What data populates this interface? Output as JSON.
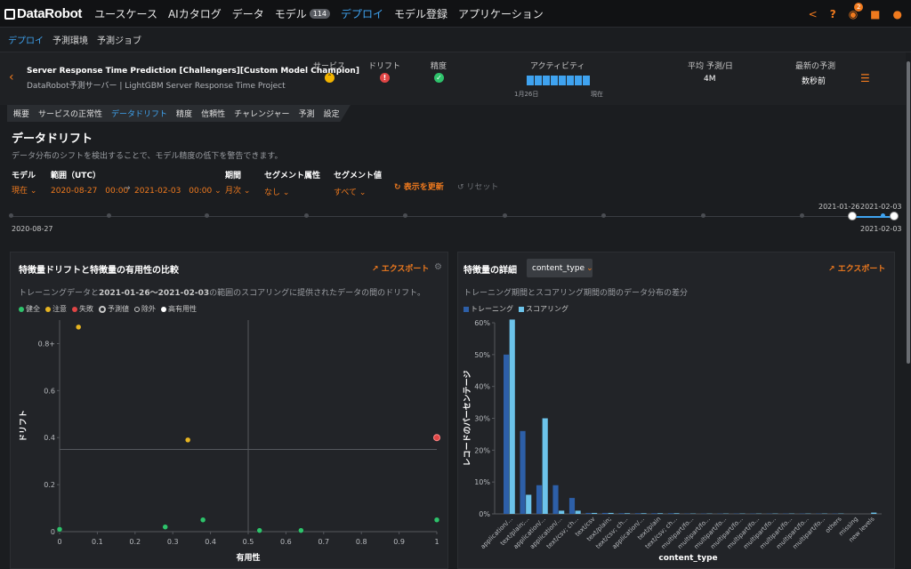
{
  "topbar": {
    "logo": "DataRobot",
    "nav": [
      "ユースケース",
      "AIカタログ",
      "データ",
      "モデル",
      "デプロイ",
      "モデル登録",
      "アプリケーション"
    ],
    "model_badge": "114",
    "notif_count": "2",
    "icons": [
      "share-icon",
      "help-icon",
      "bell-icon",
      "folder-icon",
      "user-icon"
    ]
  },
  "subnav": [
    "デプロイ",
    "予測環境",
    "予測ジョブ"
  ],
  "deployment": {
    "title": "Server Response Time Prediction [Challengers][Custom Model Champion]",
    "subtitle": "DataRobot予測サーバー | LightGBM Server Response Time Project",
    "service_label": "サービス",
    "drift_label": "ドリフト",
    "accuracy_label": "精度",
    "activity_label": "アクティビティ",
    "activity_start": "1月26日",
    "activity_end": "現在",
    "avg_label": "平均 予測/日",
    "avg_value": "4M",
    "latest_label": "最新の予測",
    "latest_value": "数秒前",
    "status_colors": {
      "service": "#f2b400",
      "drift": "#e04545",
      "accuracy": "#2ec26b"
    }
  },
  "tabs": [
    "概要",
    "サービスの正常性",
    "データドリフト",
    "精度",
    "信頼性",
    "チャレンジャー",
    "予測",
    "設定"
  ],
  "page": {
    "title": "データドリフト",
    "description": "データ分布のシフトを検出することで、モデル精度の低下を警告できます。"
  },
  "controls": {
    "model_label": "モデル",
    "model_value": "現在",
    "range_label": "範囲（UTC）",
    "range_start": "2020-08-27　00:00",
    "range_end": "2021-02-03　00:00",
    "period_label": "期間",
    "period_value": "月次",
    "segment_attr_label": "セグメント属性",
    "segment_attr_value": "なし",
    "segment_val_label": "セグメント値",
    "segment_val_value": "すべて",
    "refresh": "表示を更新",
    "reset": "リセット"
  },
  "timeline": {
    "start": "2020-08-27",
    "end": "2021-02-03",
    "sel_start": "2021-01-26",
    "sel_end": "2021-02-03"
  },
  "left_panel": {
    "title": "特徴量ドリフトと特徴量の有用性の比較",
    "export": "エクスポート",
    "desc_pre": "トレーニングデータと",
    "desc_range": "2021-01-26〜2021-02-03",
    "desc_post": "の範囲のスコアリングに提供されたデータの間のドリフト。",
    "legend": [
      "健全",
      "注意",
      "失敗",
      "予測値",
      "除外",
      "高有用性"
    ]
  },
  "right_panel": {
    "title": "特徴量の詳細",
    "select_value": "content_type",
    "export": "エクスポート",
    "desc": "トレーニング期間とスコアリング期間の間のデータ分布の差分",
    "legend": [
      "トレーニング",
      "スコアリング"
    ]
  },
  "chart_data": [
    {
      "type": "scatter",
      "xlabel": "有用性",
      "ylabel": "ドリフト",
      "xlim": [
        0,
        1
      ],
      "ylim": [
        0,
        0.9
      ],
      "x_ticks": [
        "0",
        "0.1",
        "0.2",
        "0.3",
        "0.4",
        "0.5",
        "0.6",
        "0.7",
        "0.8",
        "0.9",
        "1"
      ],
      "y_ticks": [
        "0",
        "0.2",
        "0.4",
        "0.6",
        "0.8+"
      ],
      "thresholds": {
        "x": 0.5,
        "y": 0.35
      },
      "points": [
        {
          "x": 0.0,
          "y": 0.01,
          "status": "healthy"
        },
        {
          "x": 0.05,
          "y": 0.87,
          "status": "warning"
        },
        {
          "x": 0.28,
          "y": 0.02,
          "status": "healthy"
        },
        {
          "x": 0.34,
          "y": 0.39,
          "status": "warning"
        },
        {
          "x": 0.38,
          "y": 0.05,
          "status": "healthy"
        },
        {
          "x": 0.53,
          "y": 0.005,
          "status": "healthy"
        },
        {
          "x": 0.64,
          "y": 0.005,
          "status": "healthy"
        },
        {
          "x": 1.0,
          "y": 0.4,
          "status": "failing"
        },
        {
          "x": 1.0,
          "y": 0.05,
          "status": "healthy"
        }
      ],
      "colors": {
        "healthy": "#2ec26b",
        "warning": "#e6b422",
        "failing": "#e04545"
      }
    },
    {
      "type": "bar",
      "xlabel": "content_type",
      "ylabel": "レコードのパーセンテージ",
      "ylim": [
        0,
        60
      ],
      "y_ticks": [
        "0%",
        "10%",
        "20%",
        "30%",
        "40%",
        "50%",
        "60%"
      ],
      "categories": [
        "application/...",
        "text/plain;...",
        "application/...",
        "application/...",
        "text/csv; ch...",
        "text/csv",
        "text/plain;",
        "text/csv; ch...",
        "application/...",
        "text/plain",
        "text/csv; ch...",
        "multipart/fo...",
        "multipart/fo...",
        "multipart/fo...",
        "multipart/fo...",
        "multipart/fo...",
        "multipart/fo...",
        "multipart/fo...",
        "multipart/fo...",
        "multipart/fo...",
        "others",
        "missing",
        "new levels"
      ],
      "series": [
        {
          "name": "トレーニング",
          "color": "#2d5fa8",
          "values": [
            50,
            26,
            9,
            9,
            5,
            0.3,
            0.3,
            0.2,
            0.2,
            0.2,
            0.2,
            0.1,
            0.1,
            0.1,
            0.1,
            0.1,
            0.1,
            0.1,
            0.1,
            0.1,
            0.1,
            0,
            0
          ]
        },
        {
          "name": "スコアリング",
          "color": "#6cc3ea",
          "values": [
            61,
            6,
            30,
            1,
            1,
            0.3,
            0.3,
            0.2,
            0.2,
            0.2,
            0.2,
            0.1,
            0.1,
            0.1,
            0.1,
            0.1,
            0.1,
            0.1,
            0.1,
            0.1,
            0.1,
            0,
            0.4
          ]
        }
      ]
    }
  ]
}
